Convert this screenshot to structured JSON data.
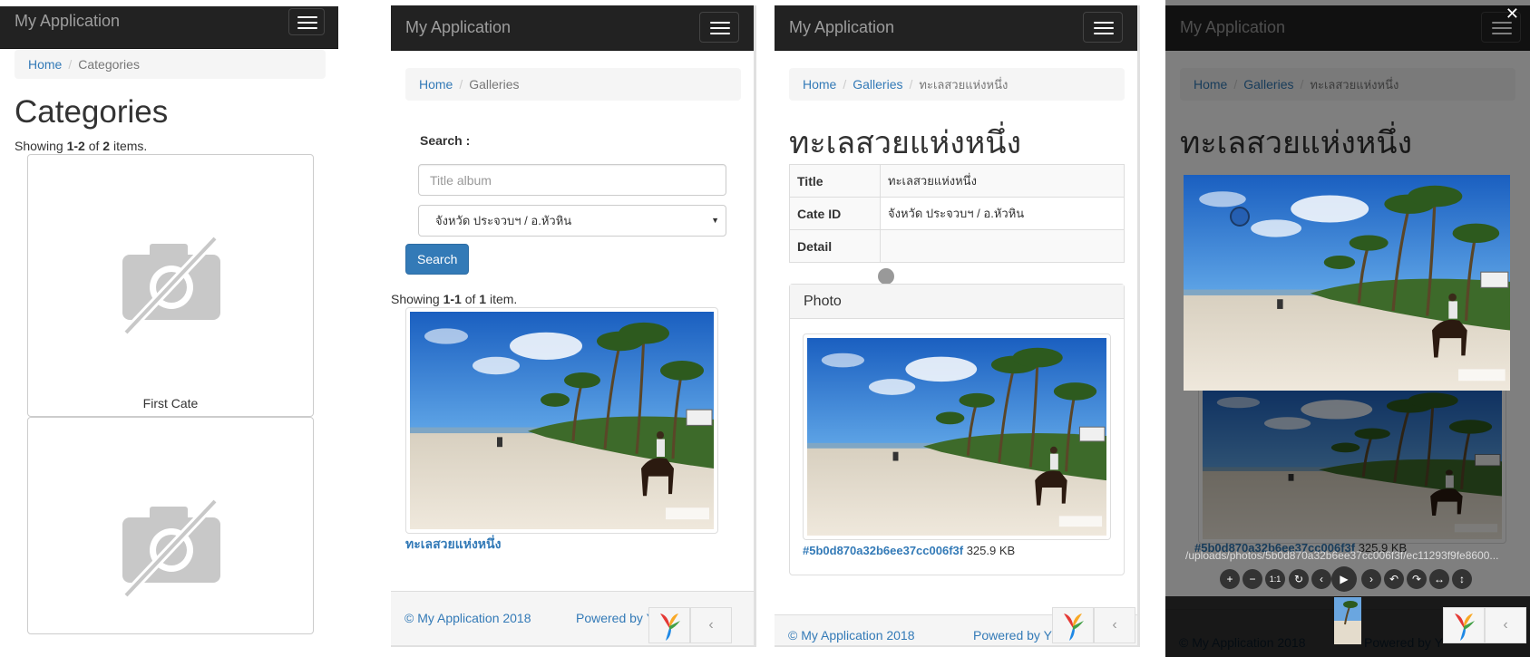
{
  "app": {
    "brand": "My Application"
  },
  "categories_page": {
    "breadcrumb": {
      "home": "Home",
      "current": "Categories"
    },
    "title": "Categories",
    "summary": {
      "prefix": "Showing ",
      "range": "1-2",
      "of": " of ",
      "total": "2",
      "suffix": " items."
    },
    "items": [
      {
        "label": "First Cate"
      },
      {
        "label": ""
      }
    ]
  },
  "galleries_page": {
    "breadcrumb": {
      "home": "Home",
      "current": "Galleries"
    },
    "search_label": "Search :",
    "title_placeholder": "Title album",
    "category_value": "จังหวัด ประจวบฯ / อ.หัวหิน",
    "search_button": "Search",
    "summary": {
      "prefix": "Showing ",
      "range": "1-1",
      "of": " of ",
      "total": "1",
      "suffix": " item."
    },
    "album_title": "ทะเลสวยแห่งหนึ่ง",
    "footer": {
      "copyright": "© My Application 2018",
      "powered": "Powered by Y"
    }
  },
  "album_page": {
    "breadcrumb": {
      "home": "Home",
      "galleries": "Galleries",
      "current": "ทะเลสวยแห่งหนึ่ง"
    },
    "title": "ทะเลสวยแห่งหนึ่ง",
    "table": [
      {
        "label": "Title",
        "value": "ทะเลสวยแห่งหนึ่ง"
      },
      {
        "label": "Cate ID",
        "value": "จังหวัด ประจวบฯ / อ.หัวหิน"
      },
      {
        "label": "Detail",
        "value": ""
      }
    ],
    "photo_heading": "Photo",
    "photo_id": "#5b0d870a32b6ee37cc006f3f",
    "photo_size": " 325.9 KB",
    "footer": {
      "copyright": "© My Application 2018",
      "powered": "Powered by Y"
    }
  },
  "viewer": {
    "path": "/uploads/photos/5b0d870a32b6ee37cc006f3f/ec11293f9fe8600...",
    "buttons": [
      {
        "name": "zoom-in-icon",
        "glyph": "+"
      },
      {
        "name": "zoom-out-icon",
        "glyph": "−"
      },
      {
        "name": "one-to-one-icon",
        "glyph": "1:1"
      },
      {
        "name": "reset-icon",
        "glyph": "↻"
      },
      {
        "name": "prev-icon",
        "glyph": "‹"
      },
      {
        "name": "play-icon",
        "glyph": "▶"
      },
      {
        "name": "next-icon",
        "glyph": "›"
      },
      {
        "name": "rotate-left-icon",
        "glyph": "↶"
      },
      {
        "name": "rotate-right-icon",
        "glyph": "↷"
      },
      {
        "name": "flip-horizontal-icon",
        "glyph": "↔"
      },
      {
        "name": "flip-vertical-icon",
        "glyph": "↕"
      }
    ]
  },
  "debug_toolbar": {
    "collapse_glyph": "‹"
  },
  "colors": {
    "navbar": "#222222",
    "brand_text": "#9d9d9d",
    "link": "#337ab7",
    "primary": "#337ab7"
  },
  "icons": {
    "menu": "hamburger-icon",
    "no_image": "camera-off-icon",
    "close": "close-icon",
    "yii_logo": "yii-logo-icon"
  }
}
